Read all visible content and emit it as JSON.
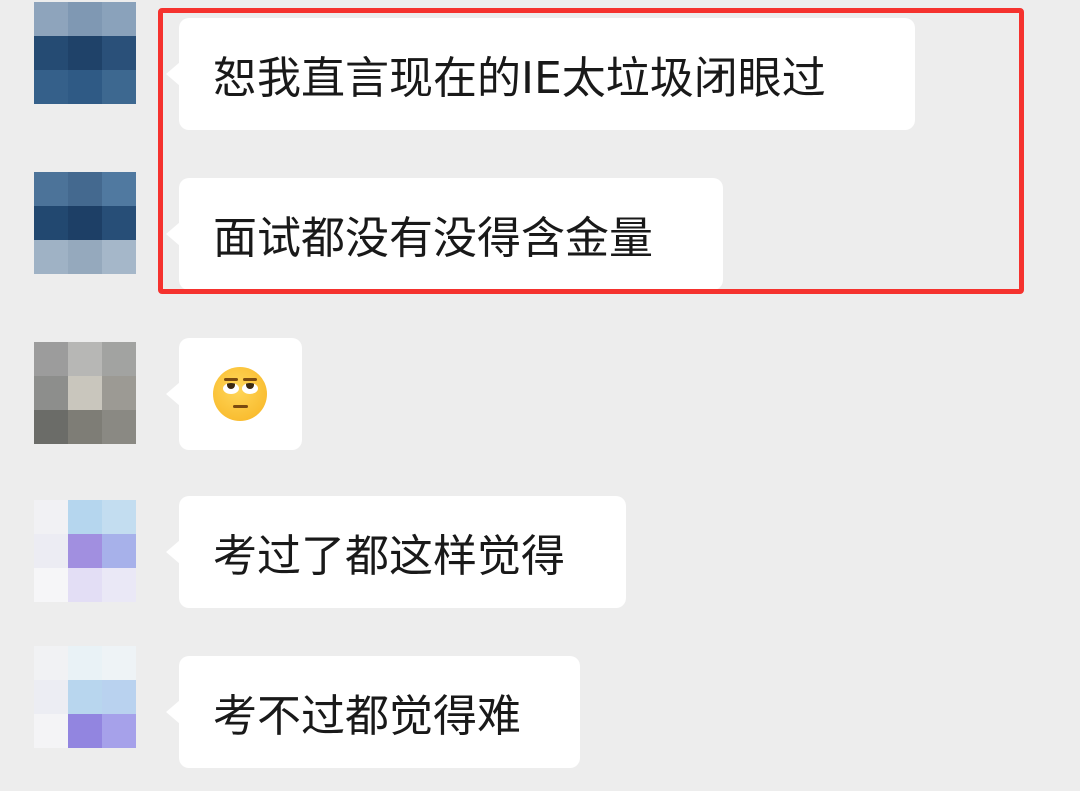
{
  "colors": {
    "background": "#ededed",
    "bubble": "#ffffff",
    "text": "#191919",
    "highlight": "#f5322e"
  },
  "messages": [
    {
      "text": "恕我直言现在的IE太垃圾闭眼过"
    },
    {
      "text": "面试都没有没得含金量"
    },
    {
      "emoji": "face-with-rolling-eyes-emoji"
    },
    {
      "text": "考过了都这样觉得"
    },
    {
      "text": "考不过都觉得难"
    }
  ]
}
